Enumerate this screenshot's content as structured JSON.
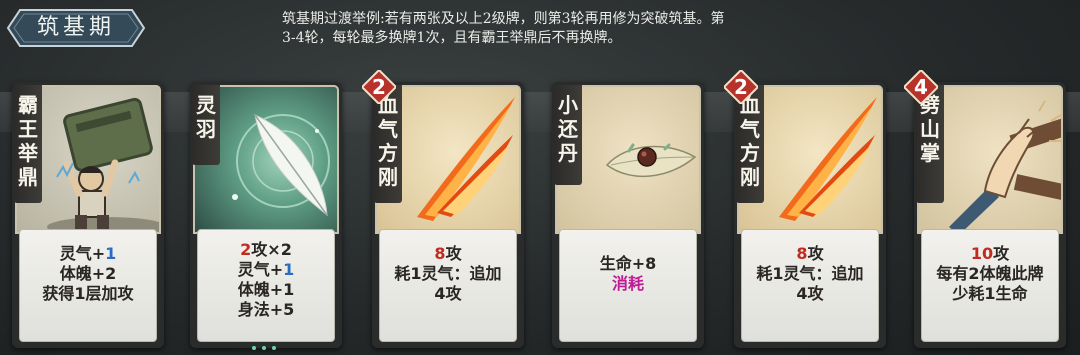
{
  "header": {
    "stage_title": "筑基期",
    "note_line1": "筑基期过渡举例:若有两张及以上2级牌，则第3轮再用修为突破筑基。第",
    "note_line2": "3-4轮，每轮最多换牌1次，且有霸王举鼎后不再换牌。"
  },
  "colors": {
    "accent_red": "#c22a1f",
    "accent_blue": "#2a6cc3",
    "accent_magenta": "#c01a95"
  },
  "cards": [
    {
      "name": "霸王举鼎",
      "cost": "",
      "art": "man-lifting-cauldron",
      "lines": [
        [
          "灵气+",
          "1"
        ],
        [
          "体魄+2",
          ""
        ],
        [
          "获得1层加攻",
          ""
        ]
      ]
    },
    {
      "name": "灵羽",
      "cost": "",
      "art": "white-feather",
      "lines": [
        [
          "2",
          "攻×2"
        ],
        [
          "灵气+",
          "1"
        ],
        [
          "体魄+1",
          ""
        ],
        [
          "身法+5",
          ""
        ]
      ]
    },
    {
      "name": "血气方刚",
      "cost": "2",
      "art": "flame-slashes",
      "lines": [
        [
          "8",
          "攻"
        ],
        [
          "耗1灵气：追加",
          ""
        ],
        [
          "4攻",
          ""
        ]
      ]
    },
    {
      "name": "小还丹",
      "cost": "",
      "art": "pill-on-leaf",
      "lines": [
        [
          "生命+8",
          ""
        ],
        [
          "消耗",
          ""
        ]
      ]
    },
    {
      "name": "血气方刚",
      "cost": "2",
      "art": "flame-slashes",
      "lines": [
        [
          "8",
          "攻"
        ],
        [
          "耗1灵气：追加",
          ""
        ],
        [
          "4攻",
          ""
        ]
      ]
    },
    {
      "name": "劈山掌",
      "cost": "4",
      "art": "open-palm-strike",
      "lines": [
        [
          "10",
          "攻"
        ],
        [
          "每有2体魄此牌",
          ""
        ],
        [
          "少耗1生命",
          ""
        ]
      ]
    }
  ]
}
